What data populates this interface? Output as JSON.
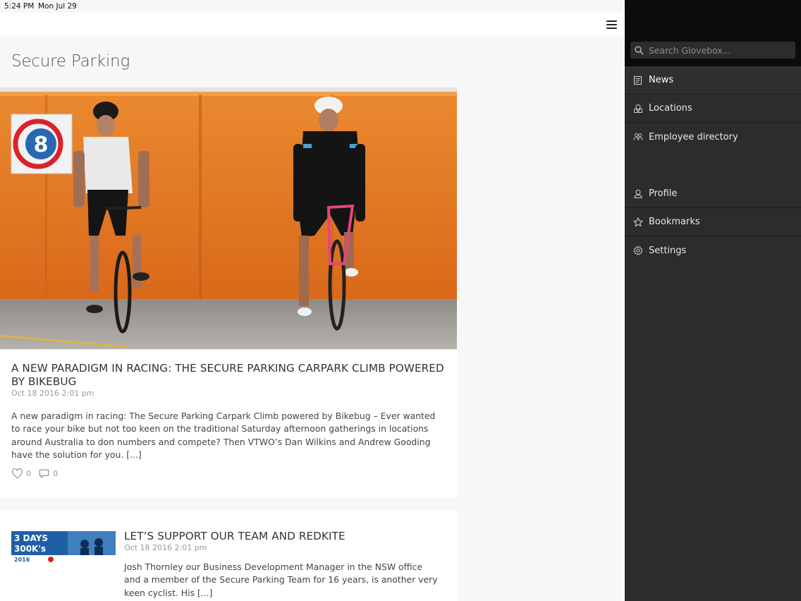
{
  "status_bar": {
    "time": "5:24 PM",
    "date": "Mon Jul 29"
  },
  "page": {
    "title": "Secure Parking"
  },
  "articles": [
    {
      "title": "A NEW PARADIGM IN RACING: THE SECURE PARKING CARPARK CLIMB POWERED BY BIKEBUG",
      "date": "Oct 18 2016 2:01 pm",
      "excerpt": "A new paradigm in racing: The Secure Parking Carpark Climb powered by Bikebug – Ever wanted to race your bike but not too keen on the traditional Saturday afternoon gatherings in locations around Australia to don numbers and compete? Then VTWO’s Dan Wilkins and Andrew Gooding have the solution for you. [...]",
      "likes": "0",
      "comments": "0",
      "image_text": "8"
    },
    {
      "title": "LET’S SUPPORT OUR TEAM AND REDKITE",
      "date": "Oct 18 2016 2:01 pm",
      "excerpt": "Josh Thornley our Business Development Manager in the NSW office and a member of the Secure Parking Team for 16 years, is another very keen cyclist. His [...]",
      "thumb_line1": "3 DAYS",
      "thumb_line2": "300K's",
      "thumb_year": "2016"
    }
  ],
  "sidebar": {
    "search_placeholder": "Search Glovebox...",
    "items": [
      {
        "label": "News",
        "icon": "news-icon",
        "active": true
      },
      {
        "label": "Locations",
        "icon": "map-icon"
      },
      {
        "label": "Employee directory",
        "icon": "people-icon"
      },
      {
        "label": "Profile",
        "icon": "person-icon"
      },
      {
        "label": "Bookmarks",
        "icon": "star-icon"
      },
      {
        "label": "Settings",
        "icon": "gear-icon"
      }
    ]
  },
  "colors": {
    "sidebar_bg": "#2c2b2d",
    "sidebar_header": "#0c0b0e",
    "page_bg": "#f7f6f8",
    "wall_orange": "#e07a24"
  }
}
